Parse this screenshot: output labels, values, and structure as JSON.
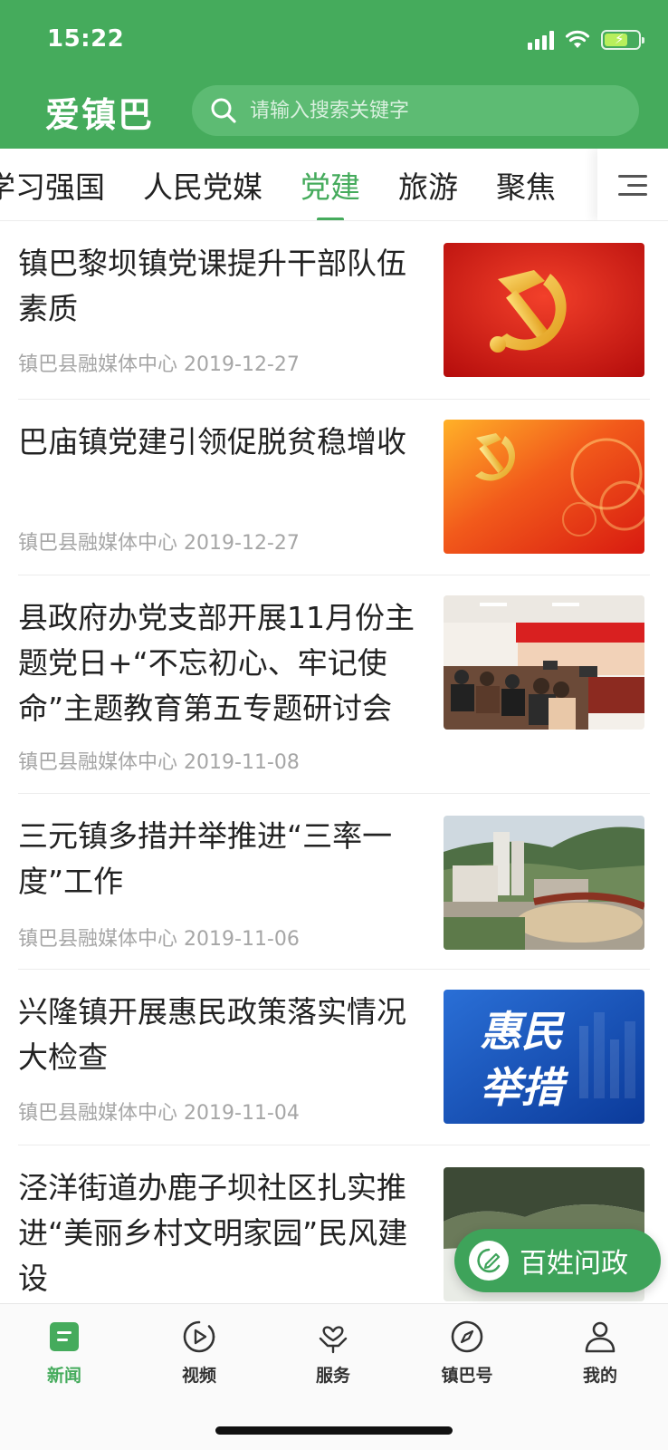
{
  "status_bar": {
    "time": "15:22"
  },
  "header": {
    "app_name": "爱镇巴",
    "search_placeholder": "请输入搜索关键字"
  },
  "tabs": [
    {
      "label": "学习强国",
      "active": false
    },
    {
      "label": "人民党媒",
      "active": false
    },
    {
      "label": "党建",
      "active": true
    },
    {
      "label": "旅游",
      "active": false
    },
    {
      "label": "聚焦",
      "active": false
    }
  ],
  "news": [
    {
      "title": "镇巴黎坝镇党课提升干部队伍素质",
      "source": "镇巴县融媒体中心",
      "date": "2019-12-27",
      "thumb": "party-emblem-image"
    },
    {
      "title": "巴庙镇党建引领促脱贫稳增收",
      "source": "镇巴县融媒体中心",
      "date": "2019-12-27",
      "thumb": "party-emblem-image"
    },
    {
      "title": "县政府办党支部开展11月份主题党日+“不忘初心、牢记使命”主题教育第五专题研讨会",
      "source": "镇巴县融媒体中心",
      "date": "2019-11-08",
      "thumb": "meeting-room-photo"
    },
    {
      "title": "三元镇多措并举推进“三率一度”工作",
      "source": "镇巴县融媒体中心",
      "date": "2019-11-06",
      "thumb": "town-aerial-photo"
    },
    {
      "title": "兴隆镇开展惠民政策落实情况大检查",
      "source": "镇巴县融媒体中心",
      "date": "2019-11-04",
      "thumb": "huimin-calligraphy-image"
    },
    {
      "title": "泾洋街道办鹿子坝社区扎实推进“美丽乡村文明家园”民风建设",
      "source": "",
      "date": "",
      "thumb": "hillside-village-photo"
    }
  ],
  "thumb_text": {
    "huimin_line1": "惠民",
    "huimin_line2": "举措"
  },
  "float_button": {
    "label": "百姓问政"
  },
  "bottom_nav": [
    {
      "label": "新闻",
      "icon": "news-icon",
      "active": true
    },
    {
      "label": "视频",
      "icon": "video-icon",
      "active": false
    },
    {
      "label": "服务",
      "icon": "service-icon",
      "active": false
    },
    {
      "label": "镇巴号",
      "icon": "compass-icon",
      "active": false
    },
    {
      "label": "我的",
      "icon": "profile-icon",
      "active": false
    }
  ],
  "colors": {
    "brand_green": "#45ab5c",
    "meta_gray": "#a6a6a6"
  }
}
